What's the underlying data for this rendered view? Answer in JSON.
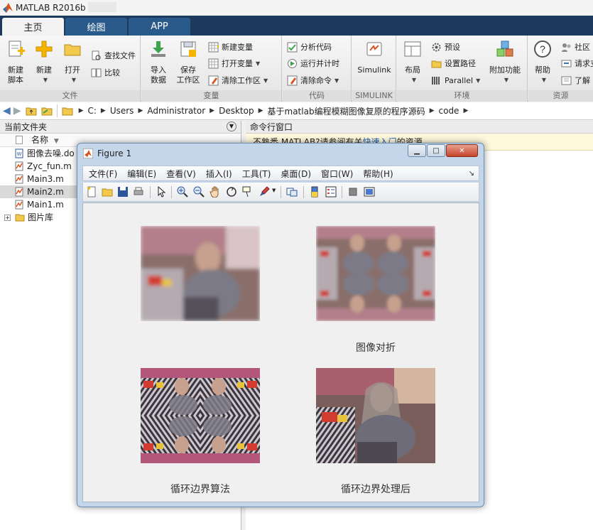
{
  "app": {
    "title": "MATLAB R2016b"
  },
  "ribbon": {
    "tabs": [
      {
        "label": "主页",
        "active": true
      },
      {
        "label": "绘图",
        "active": false
      },
      {
        "label": "APP",
        "active": false
      }
    ],
    "file_group": {
      "label": "文件",
      "new_script": [
        "新建",
        "脚本"
      ],
      "new": "新建",
      "open": "打开",
      "find_files": "查找文件",
      "compare": "比较"
    },
    "variable_group": {
      "label": "变量",
      "import_data": [
        "导入",
        "数据"
      ],
      "save_workspace": [
        "保存",
        "工作区"
      ],
      "new_variable": "新建变量",
      "open_variable": "打开变量",
      "clear_workspace": "清除工作区"
    },
    "code_group": {
      "label": "代码",
      "analyze_code": "分析代码",
      "run_and_time": "运行并计时",
      "clear_commands": "清除命令"
    },
    "simulink_group": {
      "label": "SIMULINK",
      "simulink": "Simulink"
    },
    "environment_group": {
      "label": "环境",
      "layout": "布局",
      "preferences": "预设",
      "set_path": "设置路径",
      "parallel": "Parallel",
      "addons": "附加功能"
    },
    "resources_group": {
      "label": "资源",
      "help": "帮助",
      "community": "社区",
      "request_support": "请求支",
      "learn": "了解"
    }
  },
  "address": {
    "crumbs": [
      "C:",
      "Users",
      "Administrator",
      "Desktop",
      "基于matlab编程模糊图像复原的程序源码",
      "code"
    ]
  },
  "current_folder": {
    "title": "当前文件夹",
    "name_column": "名称",
    "files": [
      {
        "name": "图像去噪.do",
        "type": "doc",
        "selected": false
      },
      {
        "name": "Zyc_fun.m",
        "type": "m",
        "selected": false
      },
      {
        "name": "Main3.m",
        "type": "m",
        "selected": false
      },
      {
        "name": "Main2.m",
        "type": "m",
        "selected": true
      },
      {
        "name": "Main1.m",
        "type": "m",
        "selected": false
      },
      {
        "name": "图片库",
        "type": "folder",
        "selected": false
      }
    ]
  },
  "command_window": {
    "title": "命令行窗口",
    "notice_prefix": "不熟悉 MATLAB?请参阅有关",
    "notice_link": "快速入门",
    "notice_suffix": "的资源。"
  },
  "figure": {
    "title": "Figure 1",
    "menu": [
      "文件(F)",
      "编辑(E)",
      "查看(V)",
      "插入(I)",
      "工具(T)",
      "桌面(D)",
      "窗口(W)",
      "帮助(H)"
    ],
    "subplots": [
      {
        "caption": ""
      },
      {
        "caption": "图像对折"
      },
      {
        "caption": "循环边界算法"
      },
      {
        "caption": "循环边界处理后"
      }
    ]
  }
}
